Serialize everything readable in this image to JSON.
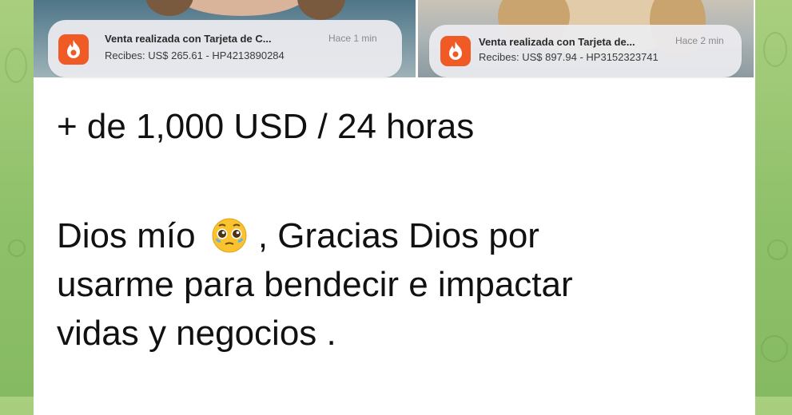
{
  "notifications": [
    {
      "title": "Venta realizada con Tarjeta de C...",
      "time": "Hace 1 min",
      "body": "Recibes: US$ 265.61 - HP4213890284",
      "icon": "flame-icon",
      "icon_color": "#f05a24"
    },
    {
      "title": "Venta realizada con Tarjeta de...",
      "time": "Hace 2 min",
      "body": "Recibes: US$ 897.94 - HP3152323741",
      "icon": "flame-icon",
      "icon_color": "#f05a24"
    }
  ],
  "message": {
    "headline": "+ de 1,000 USD / 24 horas",
    "line1_before": "Dios mío ",
    "line1_after": ", Gracias Dios por",
    "line2": "usarme para bendecir e impactar",
    "line3": "vidas y negocios ."
  },
  "colors": {
    "chat_background": "#8fc06a",
    "bubble": "#ffffff",
    "notification": "#ececf0",
    "accent": "#f05a24"
  }
}
